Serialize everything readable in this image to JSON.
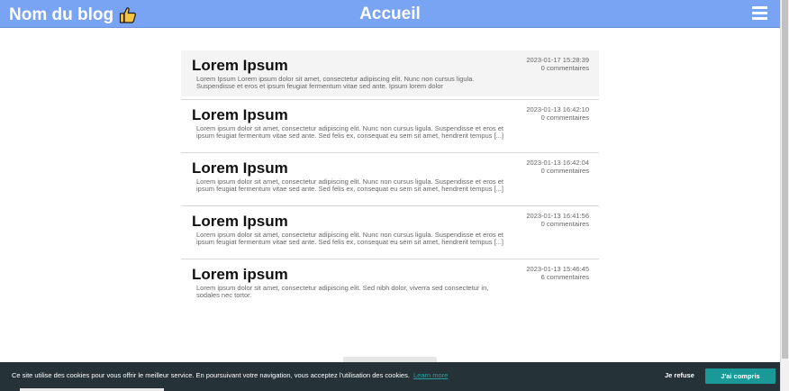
{
  "header": {
    "blog_name": "Nom du blog",
    "page_title": "Accueil",
    "accent_color": "#79a3f3"
  },
  "posts": [
    {
      "title": "Lorem Ipsum",
      "excerpt": "Lorem Ipsum Lorem ipsum dolor sit amet, consectetur adipiscing elit. Nunc non cursus ligula. Suspendisse et eros et ipsum feugiat fermentum vitae sed ante. Ipsum lorem dolor",
      "date": "2023-01-17 15:28:39",
      "comments": "0 commentaires"
    },
    {
      "title": "Lorem Ipsum",
      "excerpt": "Lorem ipsum dolor sit amet, consectetur adipiscing elit. Nunc non cursus ligula. Suspendisse et eros et ipsum feugiat fermentum vitae sed ante. Sed felis ex, consequat eu sem sit amet, hendrerit tempus [...]",
      "date": "2023-01-13 16:42:10",
      "comments": "0 commentaires"
    },
    {
      "title": "Lorem Ipsum",
      "excerpt": "Lorem ipsum dolor sit amet, consectetur adipiscing elit. Nunc non cursus ligula. Suspendisse et eros et ipsum feugiat fermentum vitae sed ante. Sed felis ex, consequat eu sem sit amet, hendrerit tempus [...]",
      "date": "2023-01-13 16:42:04",
      "comments": "0 commentaires"
    },
    {
      "title": "Lorem Ipsum",
      "excerpt": "Lorem ipsum dolor sit amet, consectetur adipiscing elit. Nunc non cursus ligula. Suspendisse et eros et ipsum feugiat fermentum vitae sed ante. Sed felis ex, consequat eu sem sit amet, hendrerit tempus [...]",
      "date": "2023-01-13 16:41:56",
      "comments": "0 commentaires"
    },
    {
      "title": "Lorem ipsum",
      "excerpt": "Lorem ipsum dolor sit amet, consectetur adipiscing elit. Sed nibh dolor, viverra sed consectetur in, sodales nec tortor.",
      "date": "2023-01-13 15:46:45",
      "comments": "6 commentaires"
    }
  ],
  "cookie_bar": {
    "message": "Ce site utilise des cookies pour vous offrir le meilleur service. En poursuivant votre navigation, vous acceptez l'utilisation des cookies.",
    "learn_more": "Learn more",
    "refuse": "Je refuse",
    "accept": "J'ai compris",
    "accept_color": "#199997"
  },
  "icons": {
    "blog_name_icon": "thumbs-up-icon",
    "menu_icon": "hamburger-menu-icon"
  }
}
